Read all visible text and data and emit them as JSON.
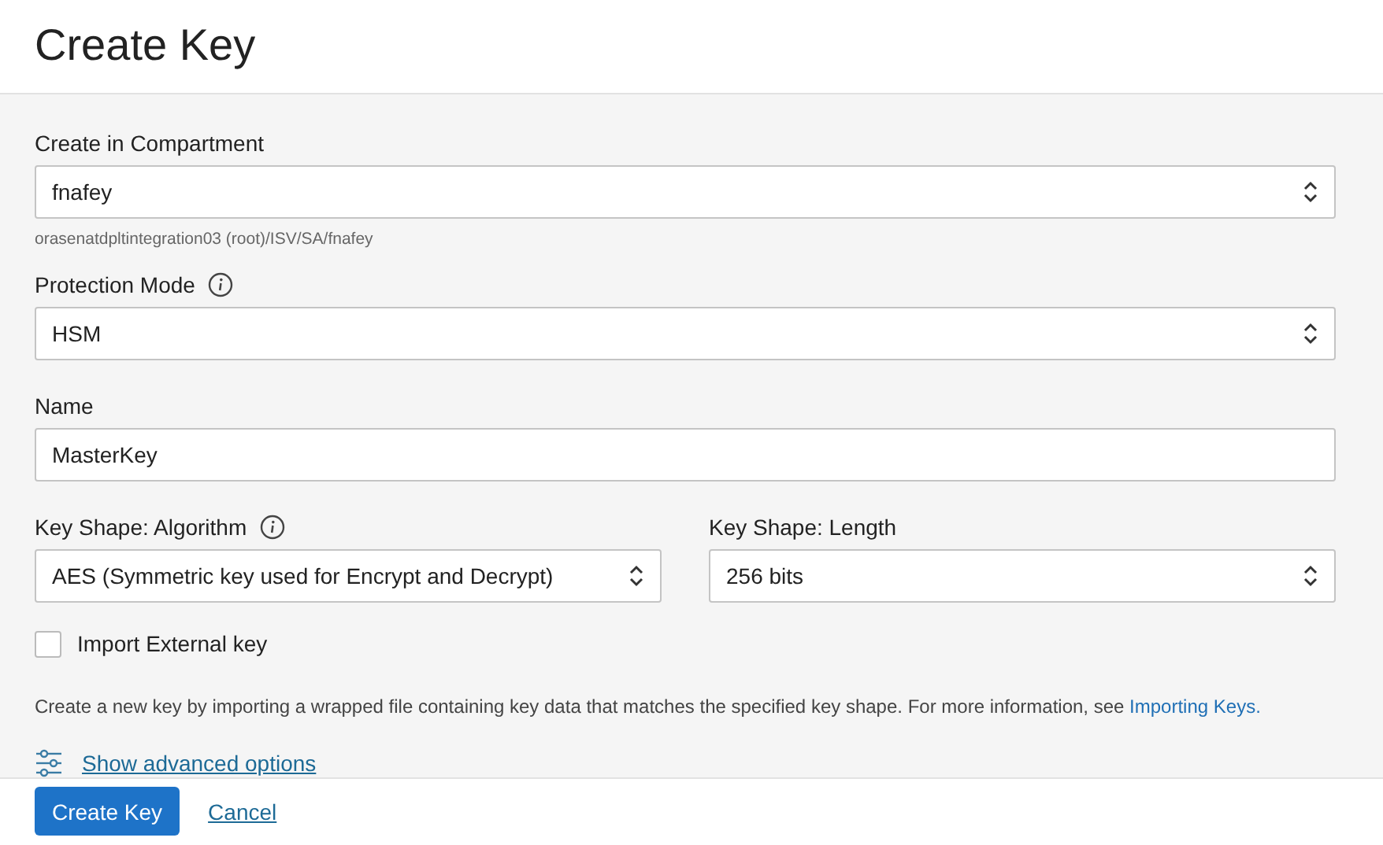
{
  "title": "Create Key",
  "rows": [
    [
      {
        "label": "Create in Compartment",
        "kind": "select",
        "value": "fnafey",
        "info": false,
        "hint": "orasenatdpltintegration03 (root)/ISV/SA/fnafey"
      }
    ],
    [
      {
        "label": "Protection Mode",
        "kind": "select",
        "value": "HSM",
        "info": true
      }
    ],
    [
      {
        "label": "Name",
        "kind": "input",
        "value": "MasterKey",
        "info": false
      }
    ],
    [
      {
        "label": "Key Shape: Algorithm",
        "kind": "select",
        "value": "AES (Symmetric key used for Encrypt and Decrypt)",
        "info": true
      },
      {
        "label": "Key Shape: Length",
        "kind": "select",
        "value": "256 bits",
        "info": false
      }
    ]
  ],
  "import_external": {
    "label": "Import External key",
    "checked": false
  },
  "help": {
    "text": "Create a new key by importing a wrapped file containing key data that matches the specified key shape. For more information, see",
    "link": "Importing Keys."
  },
  "advanced_link": "Show advanced options",
  "buttons": [
    {
      "label": "Create Key",
      "kind": "primary"
    },
    {
      "label": "Cancel",
      "kind": "link"
    }
  ]
}
